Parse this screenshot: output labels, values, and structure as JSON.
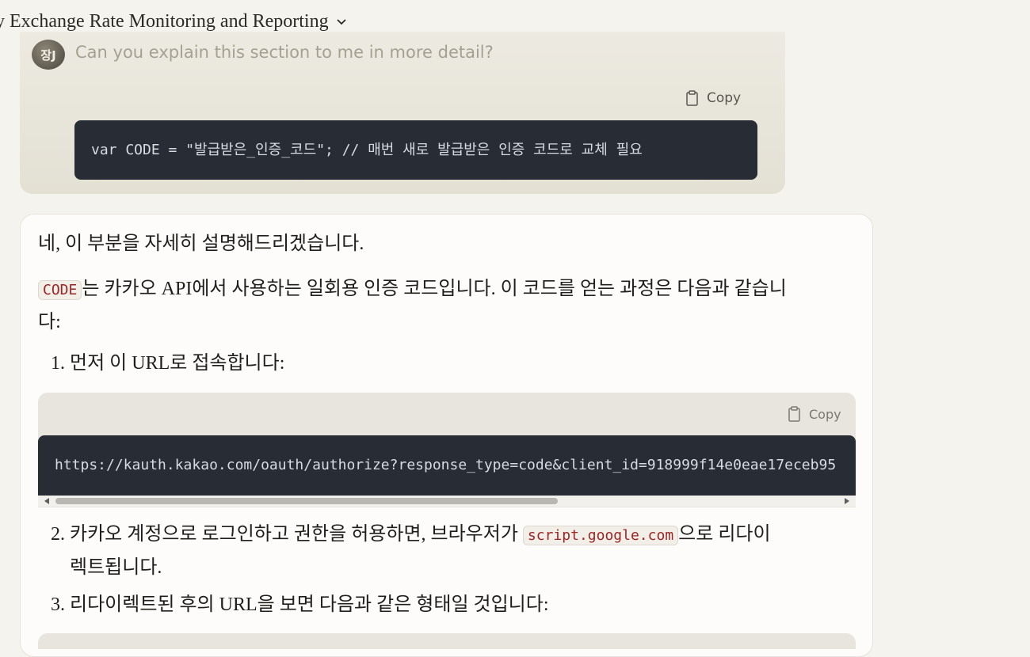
{
  "header": {
    "title": "y Exchange Rate Monitoring and Reporting"
  },
  "user_message": {
    "avatar_initials": "장J",
    "text": "Can you explain this section to me in more detail?",
    "copy_label": "Copy",
    "code": "var CODE = \"발급받은_인증_코드\"; // 매번 새로 발급받은 인증 코드로 교체 필요"
  },
  "assistant": {
    "intro": "네, 이 부분을 자세히 설명해드리겠습니다.",
    "code_inline": "CODE",
    "para2_line1": "는 카카오 API에서 사용하는 일회용 인증 코드입니다. 이 코드를 얻는 과정은 다음과 같습니",
    "para2_line2": "다:",
    "step1": "1. 먼저 이 URL로 접속합니다:",
    "copy_label": "Copy",
    "url_code": "https://kauth.kakao.com/oauth/authorize?response_type=code&client_id=918999f14e0eae17eceb95",
    "step2_before": "2. 카카오 계정으로 로그인하고 권한을 허용하면, 브라우저가 ",
    "step2_code": "script.google.com",
    "step2_after": "으로 리다이",
    "step2_line2": "렉트됩니다.",
    "step3": "3. 리다이렉트된 후의 URL을 보면 다음과 같은 형태일 것입니다:"
  }
}
